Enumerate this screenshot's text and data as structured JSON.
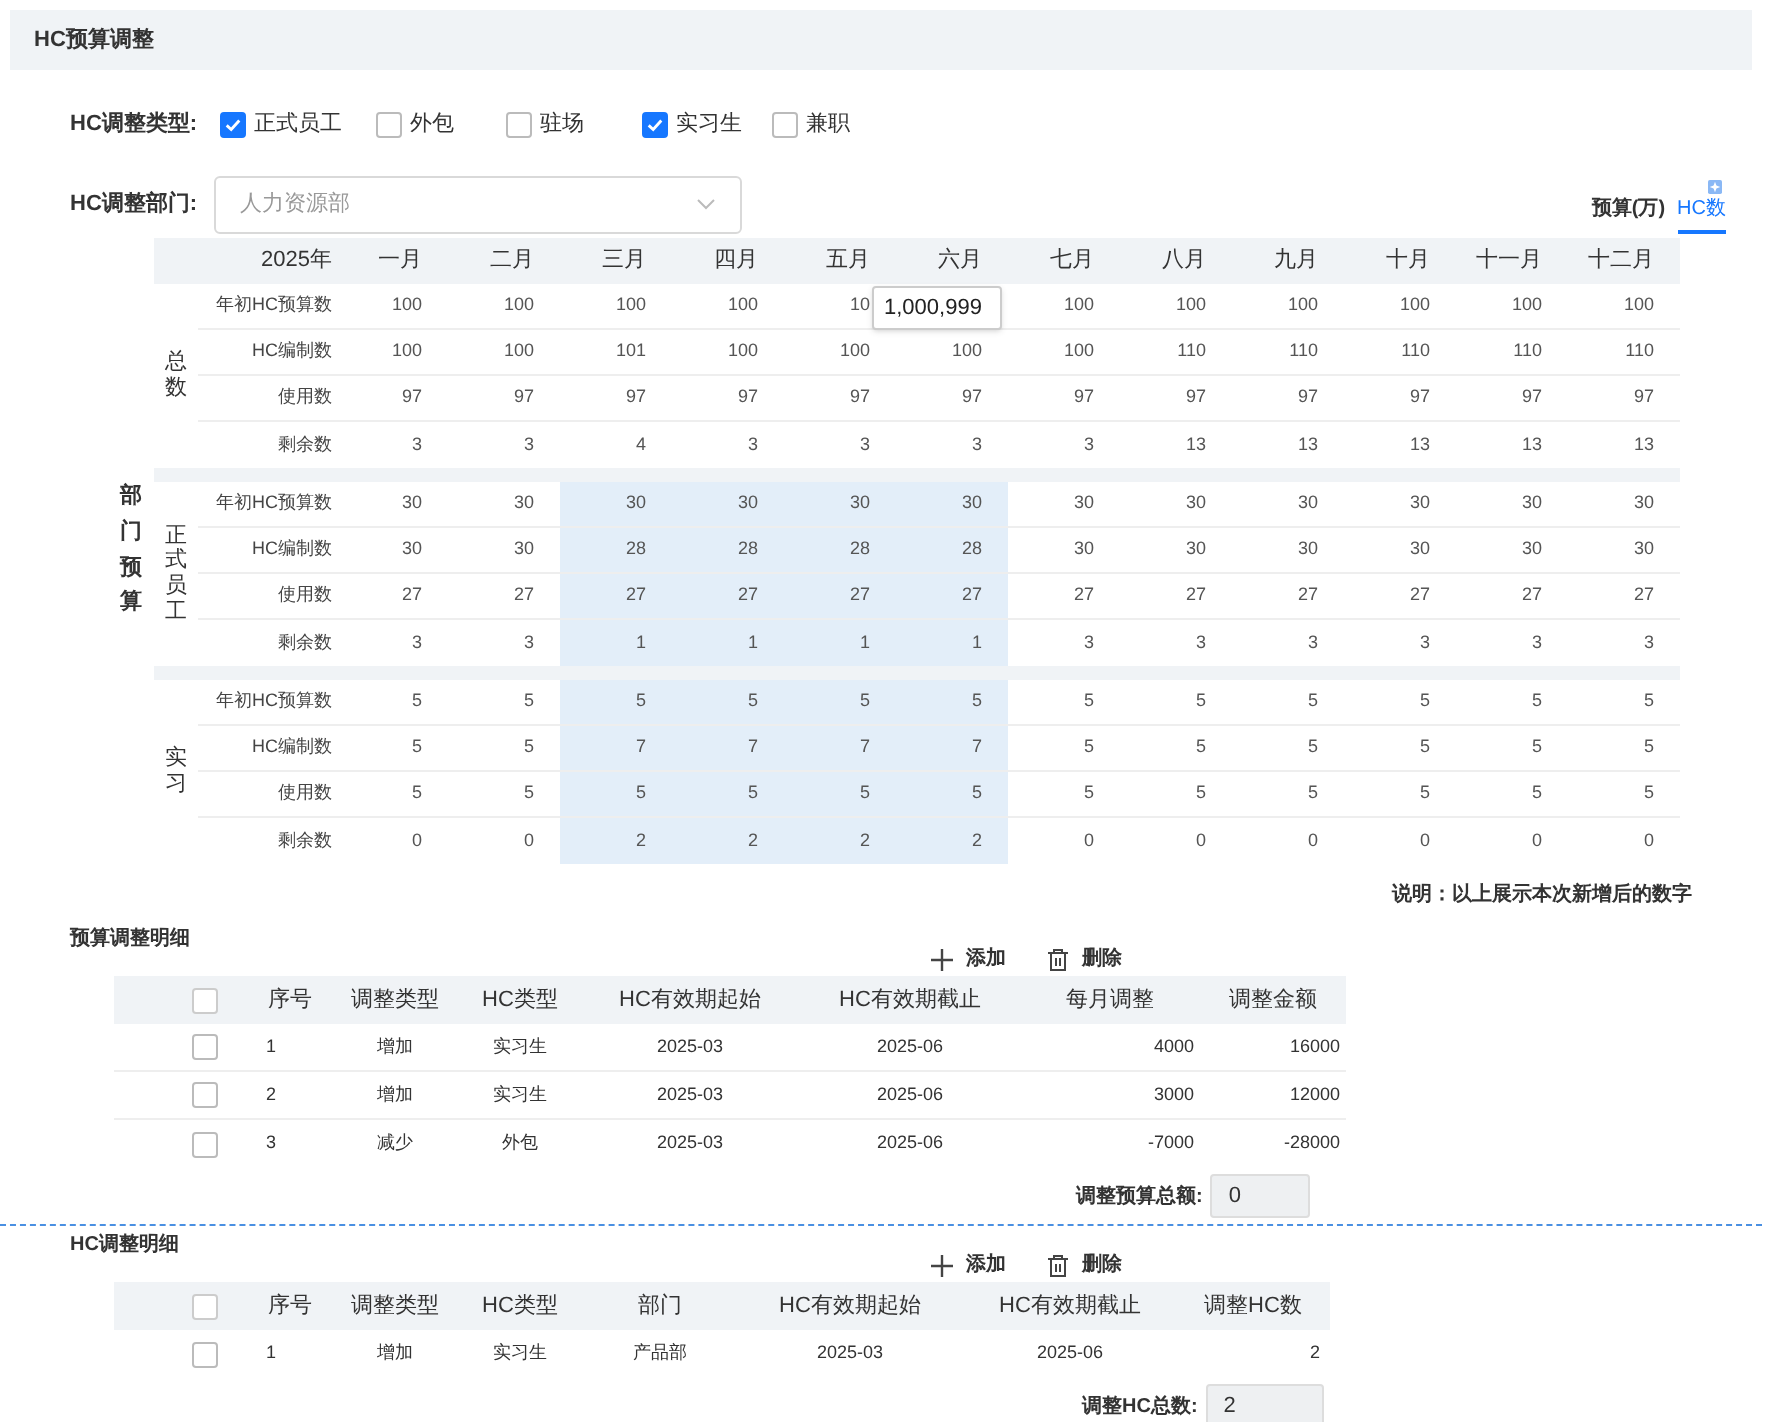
{
  "section_title": "HC预算调整",
  "type_filter": {
    "label": "HC调整类型:",
    "options": [
      {
        "label": "正式员工",
        "checked": true
      },
      {
        "label": "外包",
        "checked": false
      },
      {
        "label": "驻场",
        "checked": false
      },
      {
        "label": "实习生",
        "checked": true
      },
      {
        "label": "兼职",
        "checked": false
      }
    ]
  },
  "department_filter": {
    "label": "HC调整部门:",
    "value": "人力资源部"
  },
  "unit_toggle": [
    {
      "label": "预算(万)",
      "selected": false
    },
    {
      "label": "HC数",
      "selected": true
    }
  ],
  "budget_matrix": {
    "side_label": "部门预算",
    "year": "2025年",
    "months": [
      "一月",
      "二月",
      "三月",
      "四月",
      "五月",
      "六月",
      "七月",
      "八月",
      "九月",
      "十月",
      "十一月",
      "十二月"
    ],
    "groups": [
      {
        "label": "总数",
        "rows": [
          {
            "label": "年初HC预算数",
            "values": [
              "100",
              "100",
              "100",
              "100",
              "10",
              {
                "kind": "editor",
                "value": "1,000,999"
              },
              "100",
              "100",
              "100",
              "100",
              "100",
              "100"
            ],
            "highlighted": [
              false,
              false,
              false,
              false,
              false,
              false,
              false,
              false,
              false,
              false,
              false,
              false
            ]
          },
          {
            "label": "HC编制数",
            "values": [
              "100",
              "100",
              "101",
              "100",
              "100",
              "100",
              "100",
              "110",
              "110",
              "110",
              "110",
              "110"
            ],
            "highlighted": [
              false,
              false,
              false,
              false,
              false,
              false,
              false,
              false,
              false,
              false,
              false,
              false
            ]
          },
          {
            "label": "使用数",
            "values": [
              "97",
              "97",
              "97",
              "97",
              "97",
              "97",
              "97",
              "97",
              "97",
              "97",
              "97",
              "97"
            ],
            "highlighted": [
              false,
              false,
              false,
              false,
              false,
              false,
              false,
              false,
              false,
              false,
              false,
              false
            ]
          },
          {
            "label": "剩余数",
            "values": [
              "3",
              "3",
              "4",
              "3",
              "3",
              "3",
              "3",
              "13",
              "13",
              "13",
              "13",
              "13"
            ],
            "highlighted": [
              false,
              false,
              false,
              false,
              false,
              false,
              false,
              false,
              false,
              false,
              false,
              false
            ]
          }
        ]
      },
      {
        "label": "正式员工",
        "rows": [
          {
            "label": "年初HC预算数",
            "values": [
              "30",
              "30",
              "30",
              "30",
              "30",
              "30",
              "30",
              "30",
              "30",
              "30",
              "30",
              "30"
            ],
            "highlighted": [
              false,
              false,
              true,
              true,
              true,
              true,
              false,
              false,
              false,
              false,
              false,
              false
            ]
          },
          {
            "label": "HC编制数",
            "values": [
              "30",
              "30",
              "28",
              "28",
              "28",
              "28",
              "30",
              "30",
              "30",
              "30",
              "30",
              "30"
            ],
            "highlighted": [
              false,
              false,
              true,
              true,
              true,
              true,
              false,
              false,
              false,
              false,
              false,
              false
            ]
          },
          {
            "label": "使用数",
            "values": [
              "27",
              "27",
              "27",
              "27",
              "27",
              "27",
              "27",
              "27",
              "27",
              "27",
              "27",
              "27"
            ],
            "highlighted": [
              false,
              false,
              true,
              true,
              true,
              true,
              false,
              false,
              false,
              false,
              false,
              false
            ]
          },
          {
            "label": "剩余数",
            "values": [
              "3",
              "3",
              "1",
              "1",
              "1",
              "1",
              "3",
              "3",
              "3",
              "3",
              "3",
              "3"
            ],
            "highlighted": [
              false,
              false,
              true,
              true,
              true,
              true,
              false,
              false,
              false,
              false,
              false,
              false
            ]
          }
        ]
      },
      {
        "label": "实习",
        "rows": [
          {
            "label": "年初HC预算数",
            "values": [
              "5",
              "5",
              "5",
              "5",
              "5",
              "5",
              "5",
              "5",
              "5",
              "5",
              "5",
              "5"
            ],
            "highlighted": [
              false,
              false,
              true,
              true,
              true,
              true,
              false,
              false,
              false,
              false,
              false,
              false
            ]
          },
          {
            "label": "HC编制数",
            "values": [
              "5",
              "5",
              "7",
              "7",
              "7",
              "7",
              "5",
              "5",
              "5",
              "5",
              "5",
              "5"
            ],
            "highlighted": [
              false,
              false,
              true,
              true,
              true,
              true,
              false,
              false,
              false,
              false,
              false,
              false
            ]
          },
          {
            "label": "使用数",
            "values": [
              "5",
              "5",
              "5",
              "5",
              "5",
              "5",
              "5",
              "5",
              "5",
              "5",
              "5",
              "5"
            ],
            "highlighted": [
              false,
              false,
              true,
              true,
              true,
              true,
              false,
              false,
              false,
              false,
              false,
              false
            ]
          },
          {
            "label": "剩余数",
            "values": [
              "0",
              "0",
              "2",
              "2",
              "2",
              "2",
              "0",
              "0",
              "0",
              "0",
              "0",
              "0"
            ],
            "highlighted": [
              false,
              false,
              true,
              true,
              true,
              true,
              false,
              false,
              false,
              false,
              false,
              false
            ]
          }
        ]
      }
    ]
  },
  "note": "说明：以上展示本次新增后的数字",
  "budget_details": {
    "title": "预算调整明细",
    "actions": [
      {
        "kind": "add",
        "label": "添加"
      },
      {
        "kind": "delete",
        "label": "删除"
      }
    ],
    "header_checked": false,
    "columns": [
      "序号",
      "调整类型",
      "HC类型",
      "HC有效期起始",
      "HC有效期截止",
      "每月调整",
      "调整金额"
    ],
    "rows": [
      {
        "checked": false,
        "cells": [
          "1",
          "增加",
          "实习生",
          "2025-03",
          "2025-06",
          "4000",
          "16000"
        ]
      },
      {
        "checked": false,
        "cells": [
          "2",
          "增加",
          "实习生",
          "2025-03",
          "2025-06",
          "3000",
          "12000"
        ]
      },
      {
        "checked": false,
        "cells": [
          "3",
          "减少",
          "外包",
          "2025-03",
          "2025-06",
          "-7000",
          "-28000"
        ]
      }
    ],
    "total_label": "调整预算总额:",
    "total_value": "0"
  },
  "hc_details": {
    "title": "HC调整明细",
    "actions": [
      {
        "kind": "add",
        "label": "添加"
      },
      {
        "kind": "delete",
        "label": "删除"
      }
    ],
    "header_checked": false,
    "columns": [
      "序号",
      "调整类型",
      "HC类型",
      "部门",
      "HC有效期起始",
      "HC有效期截止",
      "调整HC数"
    ],
    "rows": [
      {
        "checked": false,
        "cells": [
          "1",
          "增加",
          "实习生",
          "产品部",
          "2025-03",
          "2025-06",
          "2"
        ]
      }
    ],
    "total_label": "调整HC总数:",
    "total_value": "2"
  }
}
